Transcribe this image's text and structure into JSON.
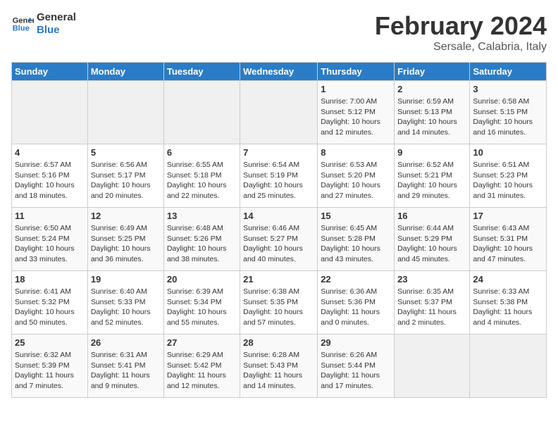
{
  "logo": {
    "line1": "General",
    "line2": "Blue"
  },
  "title": "February 2024",
  "subtitle": "Sersale, Calabria, Italy",
  "days_header": [
    "Sunday",
    "Monday",
    "Tuesday",
    "Wednesday",
    "Thursday",
    "Friday",
    "Saturday"
  ],
  "weeks": [
    [
      {
        "day": "",
        "info": ""
      },
      {
        "day": "",
        "info": ""
      },
      {
        "day": "",
        "info": ""
      },
      {
        "day": "",
        "info": ""
      },
      {
        "day": "1",
        "info": "Sunrise: 7:00 AM\nSunset: 5:12 PM\nDaylight: 10 hours\nand 12 minutes."
      },
      {
        "day": "2",
        "info": "Sunrise: 6:59 AM\nSunset: 5:13 PM\nDaylight: 10 hours\nand 14 minutes."
      },
      {
        "day": "3",
        "info": "Sunrise: 6:58 AM\nSunset: 5:15 PM\nDaylight: 10 hours\nand 16 minutes."
      }
    ],
    [
      {
        "day": "4",
        "info": "Sunrise: 6:57 AM\nSunset: 5:16 PM\nDaylight: 10 hours\nand 18 minutes."
      },
      {
        "day": "5",
        "info": "Sunrise: 6:56 AM\nSunset: 5:17 PM\nDaylight: 10 hours\nand 20 minutes."
      },
      {
        "day": "6",
        "info": "Sunrise: 6:55 AM\nSunset: 5:18 PM\nDaylight: 10 hours\nand 22 minutes."
      },
      {
        "day": "7",
        "info": "Sunrise: 6:54 AM\nSunset: 5:19 PM\nDaylight: 10 hours\nand 25 minutes."
      },
      {
        "day": "8",
        "info": "Sunrise: 6:53 AM\nSunset: 5:20 PM\nDaylight: 10 hours\nand 27 minutes."
      },
      {
        "day": "9",
        "info": "Sunrise: 6:52 AM\nSunset: 5:21 PM\nDaylight: 10 hours\nand 29 minutes."
      },
      {
        "day": "10",
        "info": "Sunrise: 6:51 AM\nSunset: 5:23 PM\nDaylight: 10 hours\nand 31 minutes."
      }
    ],
    [
      {
        "day": "11",
        "info": "Sunrise: 6:50 AM\nSunset: 5:24 PM\nDaylight: 10 hours\nand 33 minutes."
      },
      {
        "day": "12",
        "info": "Sunrise: 6:49 AM\nSunset: 5:25 PM\nDaylight: 10 hours\nand 36 minutes."
      },
      {
        "day": "13",
        "info": "Sunrise: 6:48 AM\nSunset: 5:26 PM\nDaylight: 10 hours\nand 38 minutes."
      },
      {
        "day": "14",
        "info": "Sunrise: 6:46 AM\nSunset: 5:27 PM\nDaylight: 10 hours\nand 40 minutes."
      },
      {
        "day": "15",
        "info": "Sunrise: 6:45 AM\nSunset: 5:28 PM\nDaylight: 10 hours\nand 43 minutes."
      },
      {
        "day": "16",
        "info": "Sunrise: 6:44 AM\nSunset: 5:29 PM\nDaylight: 10 hours\nand 45 minutes."
      },
      {
        "day": "17",
        "info": "Sunrise: 6:43 AM\nSunset: 5:31 PM\nDaylight: 10 hours\nand 47 minutes."
      }
    ],
    [
      {
        "day": "18",
        "info": "Sunrise: 6:41 AM\nSunset: 5:32 PM\nDaylight: 10 hours\nand 50 minutes."
      },
      {
        "day": "19",
        "info": "Sunrise: 6:40 AM\nSunset: 5:33 PM\nDaylight: 10 hours\nand 52 minutes."
      },
      {
        "day": "20",
        "info": "Sunrise: 6:39 AM\nSunset: 5:34 PM\nDaylight: 10 hours\nand 55 minutes."
      },
      {
        "day": "21",
        "info": "Sunrise: 6:38 AM\nSunset: 5:35 PM\nDaylight: 10 hours\nand 57 minutes."
      },
      {
        "day": "22",
        "info": "Sunrise: 6:36 AM\nSunset: 5:36 PM\nDaylight: 11 hours\nand 0 minutes."
      },
      {
        "day": "23",
        "info": "Sunrise: 6:35 AM\nSunset: 5:37 PM\nDaylight: 11 hours\nand 2 minutes."
      },
      {
        "day": "24",
        "info": "Sunrise: 6:33 AM\nSunset: 5:38 PM\nDaylight: 11 hours\nand 4 minutes."
      }
    ],
    [
      {
        "day": "25",
        "info": "Sunrise: 6:32 AM\nSunset: 5:39 PM\nDaylight: 11 hours\nand 7 minutes."
      },
      {
        "day": "26",
        "info": "Sunrise: 6:31 AM\nSunset: 5:41 PM\nDaylight: 11 hours\nand 9 minutes."
      },
      {
        "day": "27",
        "info": "Sunrise: 6:29 AM\nSunset: 5:42 PM\nDaylight: 11 hours\nand 12 minutes."
      },
      {
        "day": "28",
        "info": "Sunrise: 6:28 AM\nSunset: 5:43 PM\nDaylight: 11 hours\nand 14 minutes."
      },
      {
        "day": "29",
        "info": "Sunrise: 6:26 AM\nSunset: 5:44 PM\nDaylight: 11 hours\nand 17 minutes."
      },
      {
        "day": "",
        "info": ""
      },
      {
        "day": "",
        "info": ""
      }
    ]
  ]
}
